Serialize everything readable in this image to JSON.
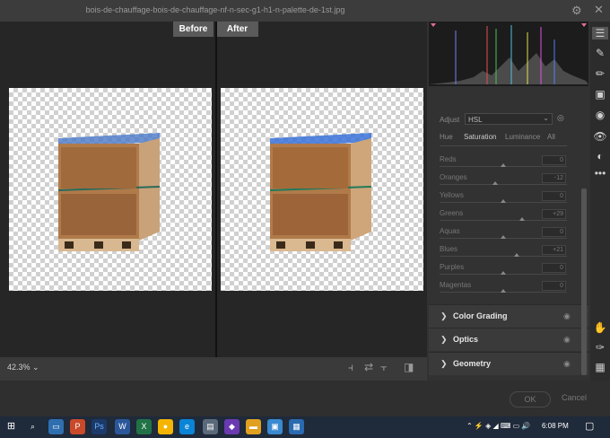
{
  "window": {
    "title": "bois-de-chauffage-bois-de-chauffage-nf-n-sec-g1-h1-n-palette-de-1st.jpg"
  },
  "compare": {
    "before_label": "Before",
    "after_label": "After"
  },
  "zoom": {
    "value": "42.3%"
  },
  "adjust": {
    "label": "Adjust",
    "mode": "HSL",
    "tabs": [
      "Hue",
      "Saturation",
      "Luminance",
      "All"
    ],
    "active_tab": "Saturation",
    "sliders": [
      {
        "name": "Reds",
        "value": "0",
        "level": 0
      },
      {
        "name": "Oranges",
        "value": "-12",
        "level": -12
      },
      {
        "name": "Yellows",
        "value": "0",
        "level": 0
      },
      {
        "name": "Greens",
        "value": "+29",
        "level": 29
      },
      {
        "name": "Aquas",
        "value": "0",
        "level": 0
      },
      {
        "name": "Blues",
        "value": "+21",
        "level": 21
      },
      {
        "name": "Purples",
        "value": "0",
        "level": 0
      },
      {
        "name": "Magentas",
        "value": "0",
        "level": 0
      }
    ]
  },
  "sections": [
    {
      "title": "Color Grading"
    },
    {
      "title": "Optics"
    },
    {
      "title": "Geometry"
    }
  ],
  "dialog": {
    "ok_label": "OK",
    "cancel_label": "Cancel"
  },
  "taskbar": {
    "time": "6:08 PM"
  },
  "colors": {
    "panel": "#323232",
    "preview_bg": "#262626",
    "taskbar": "#1f2a3a"
  }
}
